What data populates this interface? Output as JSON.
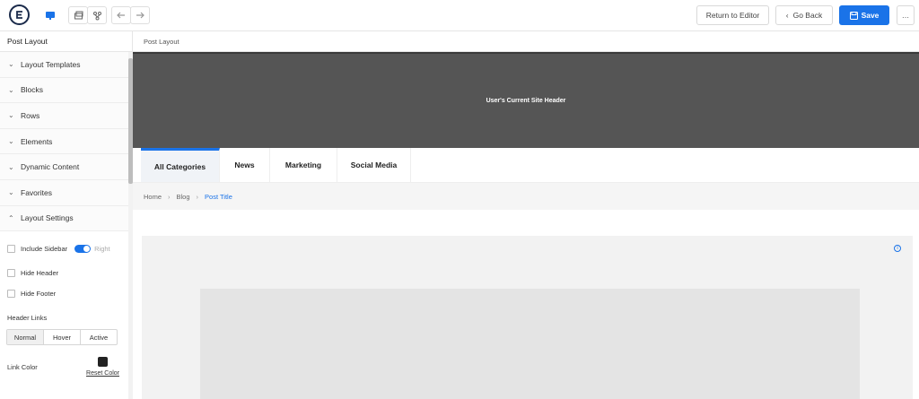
{
  "toolbar": {
    "return_label": "Return to Editor",
    "goback_label": "Go Back",
    "save_label": "Save",
    "more_label": "…"
  },
  "left_panel": {
    "title": "Post Layout",
    "sections": [
      "Layout Templates",
      "Blocks",
      "Rows",
      "Elements",
      "Dynamic Content",
      "Favorites",
      "Layout Settings"
    ],
    "options": {
      "include_sidebar": "Include Sidebar",
      "sidebar_toggle_value": "Right",
      "hide_header": "Hide Header",
      "hide_footer": "Hide Footer"
    },
    "header_links": {
      "label": "Header Links",
      "tabs": [
        "Normal",
        "Hover",
        "Active"
      ],
      "selected": "Normal"
    },
    "link_color": {
      "label": "Link Color",
      "color": "#222222",
      "reset_label": "Reset Color"
    }
  },
  "main": {
    "title": "Post Layout",
    "site_header_text": "User's Current Site Header",
    "categories": [
      "All Categories",
      "News",
      "Marketing",
      "Social Media"
    ],
    "active_category": "All Categories",
    "breadcrumb": [
      "Home",
      "Blog",
      "Post Title"
    ]
  },
  "colors": {
    "accent": "#1a73e8",
    "header_bg": "#555555"
  }
}
